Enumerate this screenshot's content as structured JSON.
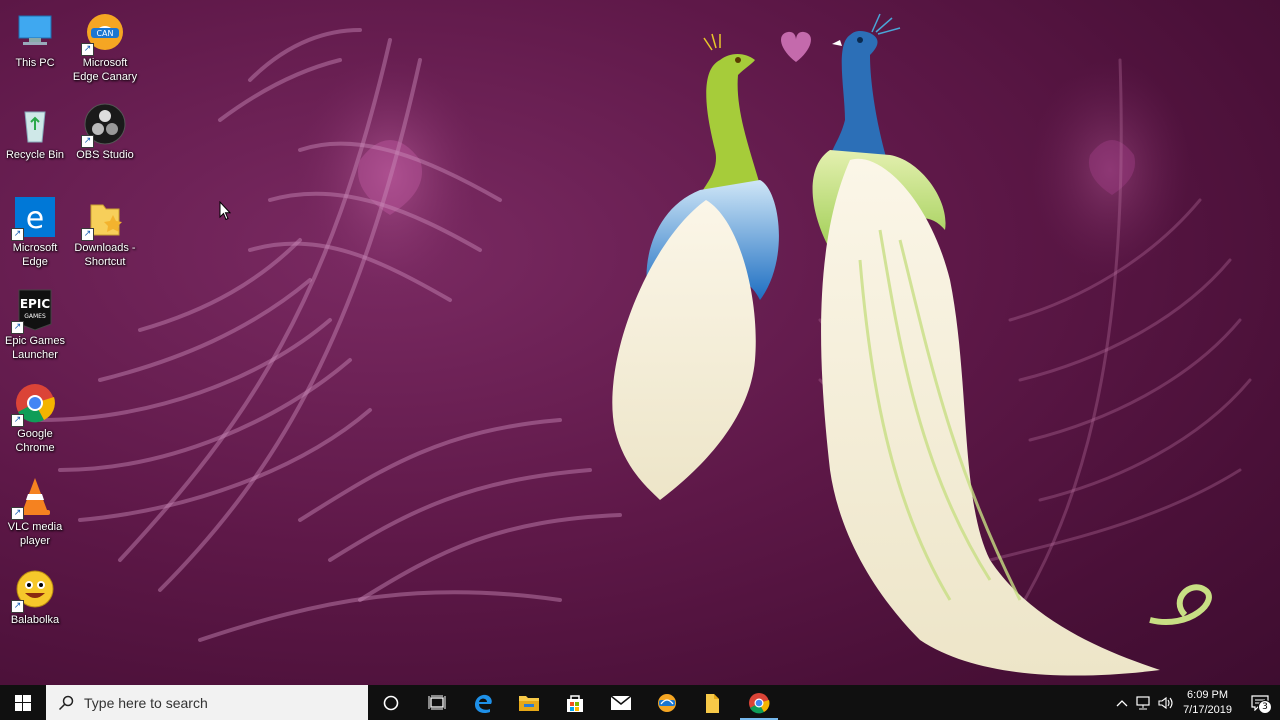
{
  "desktop": {
    "icons": [
      {
        "label": "This PC"
      },
      {
        "label": "Microsoft Edge Canary",
        "badge": "CAN"
      },
      {
        "label": "Recycle Bin"
      },
      {
        "label": "OBS Studio"
      },
      {
        "label": "Microsoft Edge",
        "glyph": "e"
      },
      {
        "label": "Downloads - Shortcut"
      },
      {
        "label": "Epic Games Launcher",
        "logo_line1": "EPIC",
        "logo_line2": "GAMES"
      },
      {
        "label": "Google Chrome"
      },
      {
        "label": "VLC media player"
      },
      {
        "label": "Balabolka"
      }
    ]
  },
  "taskbar": {
    "search_placeholder": "Type here to search",
    "pinned": [
      {
        "icon": "cortana-icon"
      },
      {
        "icon": "task-view-icon"
      },
      {
        "icon": "edge-icon"
      },
      {
        "icon": "file-explorer-icon"
      },
      {
        "icon": "microsoft-store-icon"
      },
      {
        "icon": "mail-icon"
      },
      {
        "icon": "edge-canary-icon"
      },
      {
        "icon": "folder-shortcut-icon"
      },
      {
        "icon": "chrome-icon",
        "active": true
      }
    ],
    "clock": {
      "time": "6:09 PM",
      "date": "7/17/2019"
    },
    "notification_count": "3"
  },
  "colors": {
    "wallpaper": "#5e1848",
    "taskbar": "#101010",
    "accent": "#76b9ed",
    "edge_blue": "#0078d7"
  }
}
